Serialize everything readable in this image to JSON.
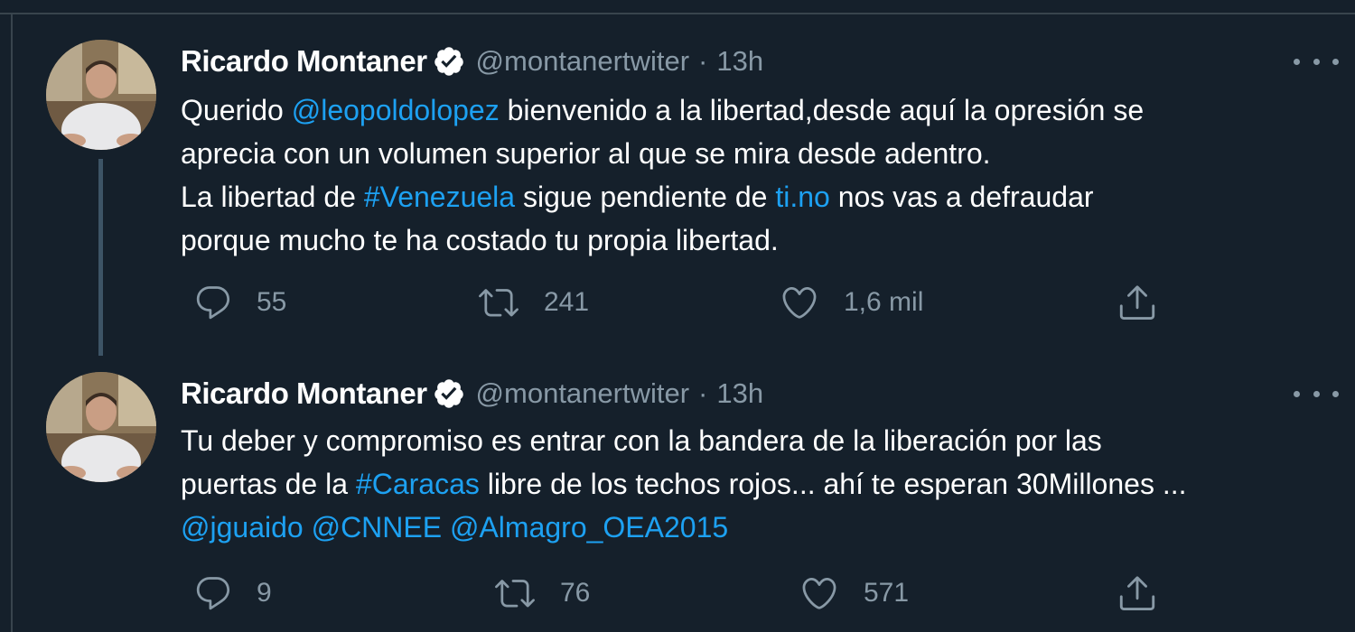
{
  "tweets": [
    {
      "display_name": "Ricardo Montaner",
      "handle": "@montanertwiter",
      "separator": "·",
      "time": "13h",
      "verified_icon": "verified-badge-icon",
      "lines": [
        [
          {
            "text": "Querido ",
            "type": "text"
          },
          {
            "text": "@leopoldolopez",
            "type": "mention"
          },
          {
            "text": " bienvenido a la libertad,desde aquí la opresión se",
            "type": "text"
          }
        ],
        [
          {
            "text": "aprecia con un volumen superior al que se mira desde adentro.",
            "type": "text"
          }
        ],
        [
          {
            "text": "La libertad de ",
            "type": "text"
          },
          {
            "text": "#Venezuela",
            "type": "hashtag"
          },
          {
            "text": " sigue pendiente de ",
            "type": "text"
          },
          {
            "text": "ti.no",
            "type": "link"
          },
          {
            "text": " nos vas a defraudar",
            "type": "text"
          }
        ],
        [
          {
            "text": "porque mucho te ha costado tu propia libertad.",
            "type": "text"
          }
        ]
      ],
      "replies": "55",
      "retweets": "241",
      "likes": "1,6 mil"
    },
    {
      "display_name": "Ricardo Montaner",
      "handle": "@montanertwiter",
      "separator": "·",
      "time": "13h",
      "verified_icon": "verified-badge-icon",
      "lines": [
        [
          {
            "text": "Tu deber y compromiso es entrar con la bandera de la liberación por las",
            "type": "text"
          }
        ],
        [
          {
            "text": "puertas de la ",
            "type": "text"
          },
          {
            "text": "#Caracas",
            "type": "hashtag"
          },
          {
            "text": " libre de los techos rojos... ahí te esperan 30Millones ...",
            "type": "text"
          }
        ],
        [
          {
            "text": "@jguaido",
            "type": "mention"
          },
          {
            "text": " ",
            "type": "text"
          },
          {
            "text": "@CNNEE",
            "type": "mention"
          },
          {
            "text": " ",
            "type": "text"
          },
          {
            "text": "@Almagro_OEA2015",
            "type": "mention"
          }
        ]
      ],
      "replies": "9",
      "retweets": "76",
      "likes": "571"
    }
  ],
  "icons": {
    "reply": "reply-icon",
    "retweet": "retweet-icon",
    "like": "like-icon",
    "share": "share-icon",
    "more": "more-options-icon"
  },
  "colors": {
    "background": "#15202b",
    "text": "#ffffff",
    "secondary_text": "#8899a6",
    "link": "#1da1f2",
    "thread_line": "#3d5466"
  }
}
